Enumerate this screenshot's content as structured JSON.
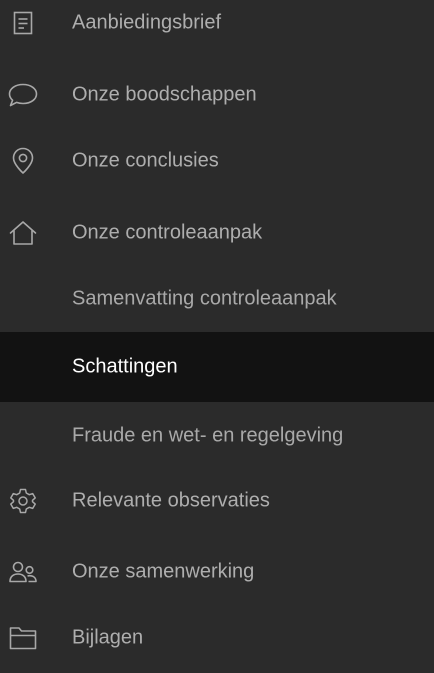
{
  "nav": {
    "items": [
      {
        "label": "Aanbiedingsbrief",
        "icon": "document-icon"
      },
      {
        "label": "Onze boodschappen",
        "icon": "chat-bubble-icon"
      },
      {
        "label": "Onze conclusies",
        "icon": "location-pin-icon"
      },
      {
        "label": "Onze controleaanpak",
        "icon": "home-icon"
      },
      {
        "label": "Samenvatting controleaanpak"
      },
      {
        "label": "Schattingen",
        "active": true
      },
      {
        "label": "Fraude en wet- en regelgeving"
      },
      {
        "label": "Relevante observaties",
        "icon": "gear-icon"
      },
      {
        "label": "Onze samenwerking",
        "icon": "users-icon"
      },
      {
        "label": "Bijlagen",
        "icon": "folder-icon"
      }
    ]
  },
  "colors": {
    "background": "#2b2b2b",
    "active_background": "#121212",
    "text": "#aeaeae",
    "active_text": "#ffffff",
    "icon": "#a8a8a8"
  }
}
